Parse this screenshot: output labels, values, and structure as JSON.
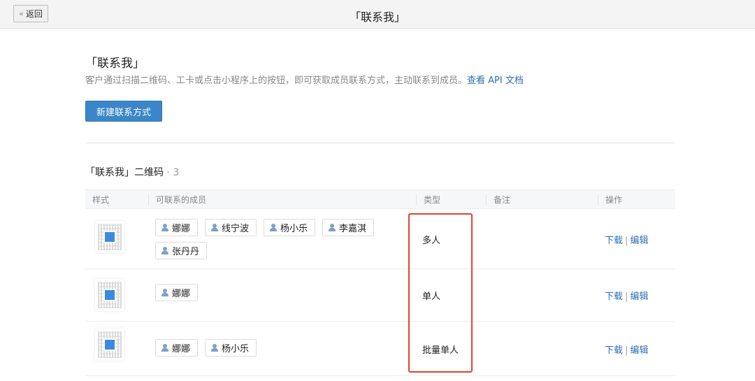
{
  "topbar": {
    "back_label": "返回",
    "title": "「联系我」"
  },
  "header": {
    "title": "「联系我」",
    "description": "客户通过扫描二维码、工卡或点击小程序上的按钮，即可获取成员联系方式，主动联系到成员。",
    "api_link": "查看 API 文档",
    "new_button": "新建联系方式"
  },
  "section": {
    "title": "「联系我」二维码",
    "count": "· 3"
  },
  "table": {
    "headers": [
      "样式",
      "可联系的成员",
      "类型",
      "备注",
      "操作"
    ],
    "rows": [
      {
        "members": [
          "娜娜",
          "线宁波",
          "杨小乐",
          "李嘉淇",
          "张丹丹"
        ],
        "type": "多人",
        "note": "",
        "download": "下载",
        "edit": "编辑"
      },
      {
        "members": [
          "娜娜"
        ],
        "type": "单人",
        "note": "",
        "download": "下载",
        "edit": "编辑"
      },
      {
        "members": [
          "娜娜",
          "杨小乐"
        ],
        "type": "批量单人",
        "note": "",
        "download": "下载",
        "edit": "编辑"
      }
    ]
  },
  "colors": {
    "accent": "#3a86c8",
    "link": "#2d6fb3",
    "highlight": "#e4432d"
  }
}
